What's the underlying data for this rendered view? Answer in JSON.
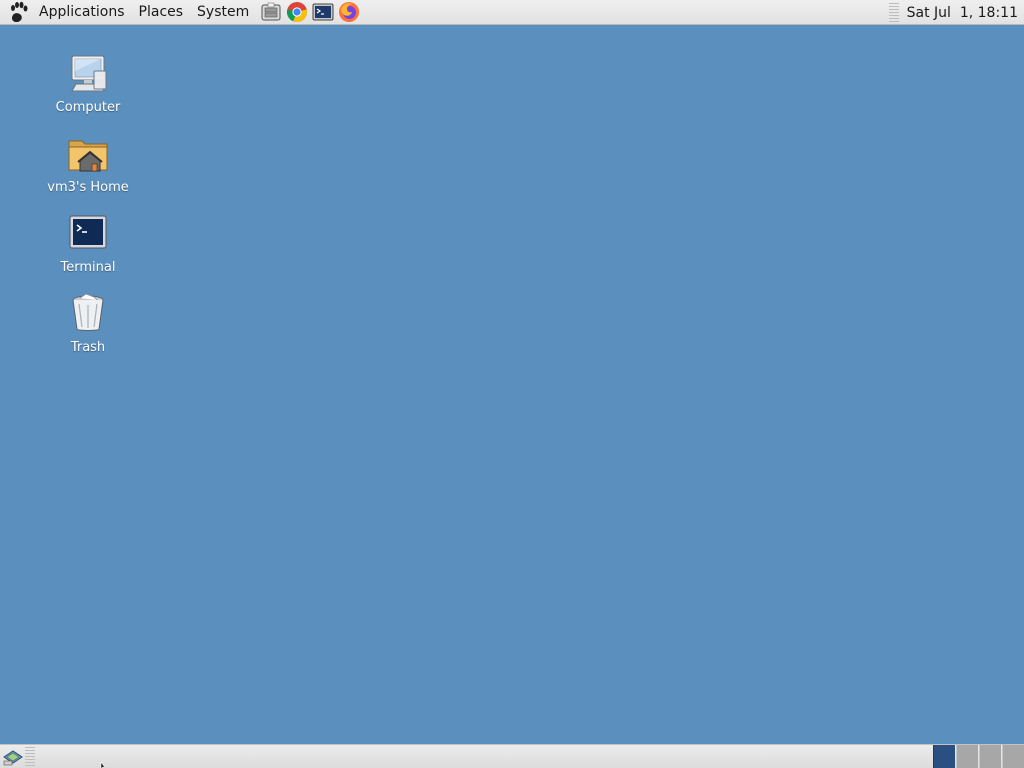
{
  "top_panel": {
    "menus": [
      "Applications",
      "Places",
      "System"
    ],
    "launchers": [
      {
        "name": "file-manager-launcher",
        "icon": "file-cabinet-icon"
      },
      {
        "name": "chrome-launcher",
        "icon": "chrome-icon"
      },
      {
        "name": "terminal-launcher",
        "icon": "terminal-icon"
      },
      {
        "name": "firefox-launcher",
        "icon": "firefox-icon"
      }
    ],
    "clock": "Sat Jul  1, 18:11"
  },
  "desktop": {
    "background_color": "#5b8fbd",
    "icons": [
      {
        "label": "Computer",
        "icon": "computer-icon"
      },
      {
        "label": "vm3's Home",
        "icon": "home-folder-icon"
      },
      {
        "label": "Terminal",
        "icon": "terminal-icon"
      },
      {
        "label": "Trash",
        "icon": "trash-icon"
      }
    ]
  },
  "bottom_panel": {
    "show_desktop_icon": "show-desktop-icon",
    "workspaces": {
      "count": 4,
      "active_index": 0,
      "active_color": "#2c4f82"
    }
  }
}
